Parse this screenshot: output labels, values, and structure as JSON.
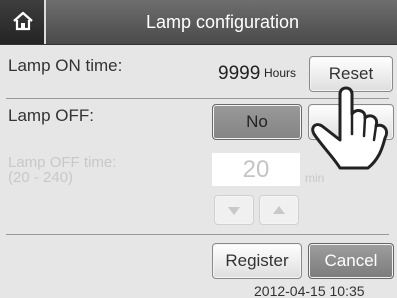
{
  "header": {
    "title": "Lamp configuration",
    "home_icon": "home-icon"
  },
  "lamp_on": {
    "label": "Lamp ON time:",
    "value": "9999",
    "unit": "Hours",
    "reset_label": "Reset"
  },
  "lamp_off": {
    "label": "Lamp OFF:",
    "no_label": "No",
    "selected": "No"
  },
  "lamp_off_time": {
    "label_line1": "Lamp OFF time:",
    "label_line2": "(20 - 240)",
    "value": "20",
    "unit": "min",
    "down_icon": "down-triangle-icon",
    "up_icon": "up-triangle-icon",
    "enabled": false
  },
  "actions": {
    "register_label": "Register",
    "cancel_label": "Cancel"
  },
  "footer": {
    "datetime": "2012-04-15 10:35"
  },
  "colors": {
    "titlebar": "#5a5a5a",
    "background": "#e6e6e6",
    "cancel_button": "#8c8c8c",
    "disabled_text": "#c8c8c8"
  }
}
